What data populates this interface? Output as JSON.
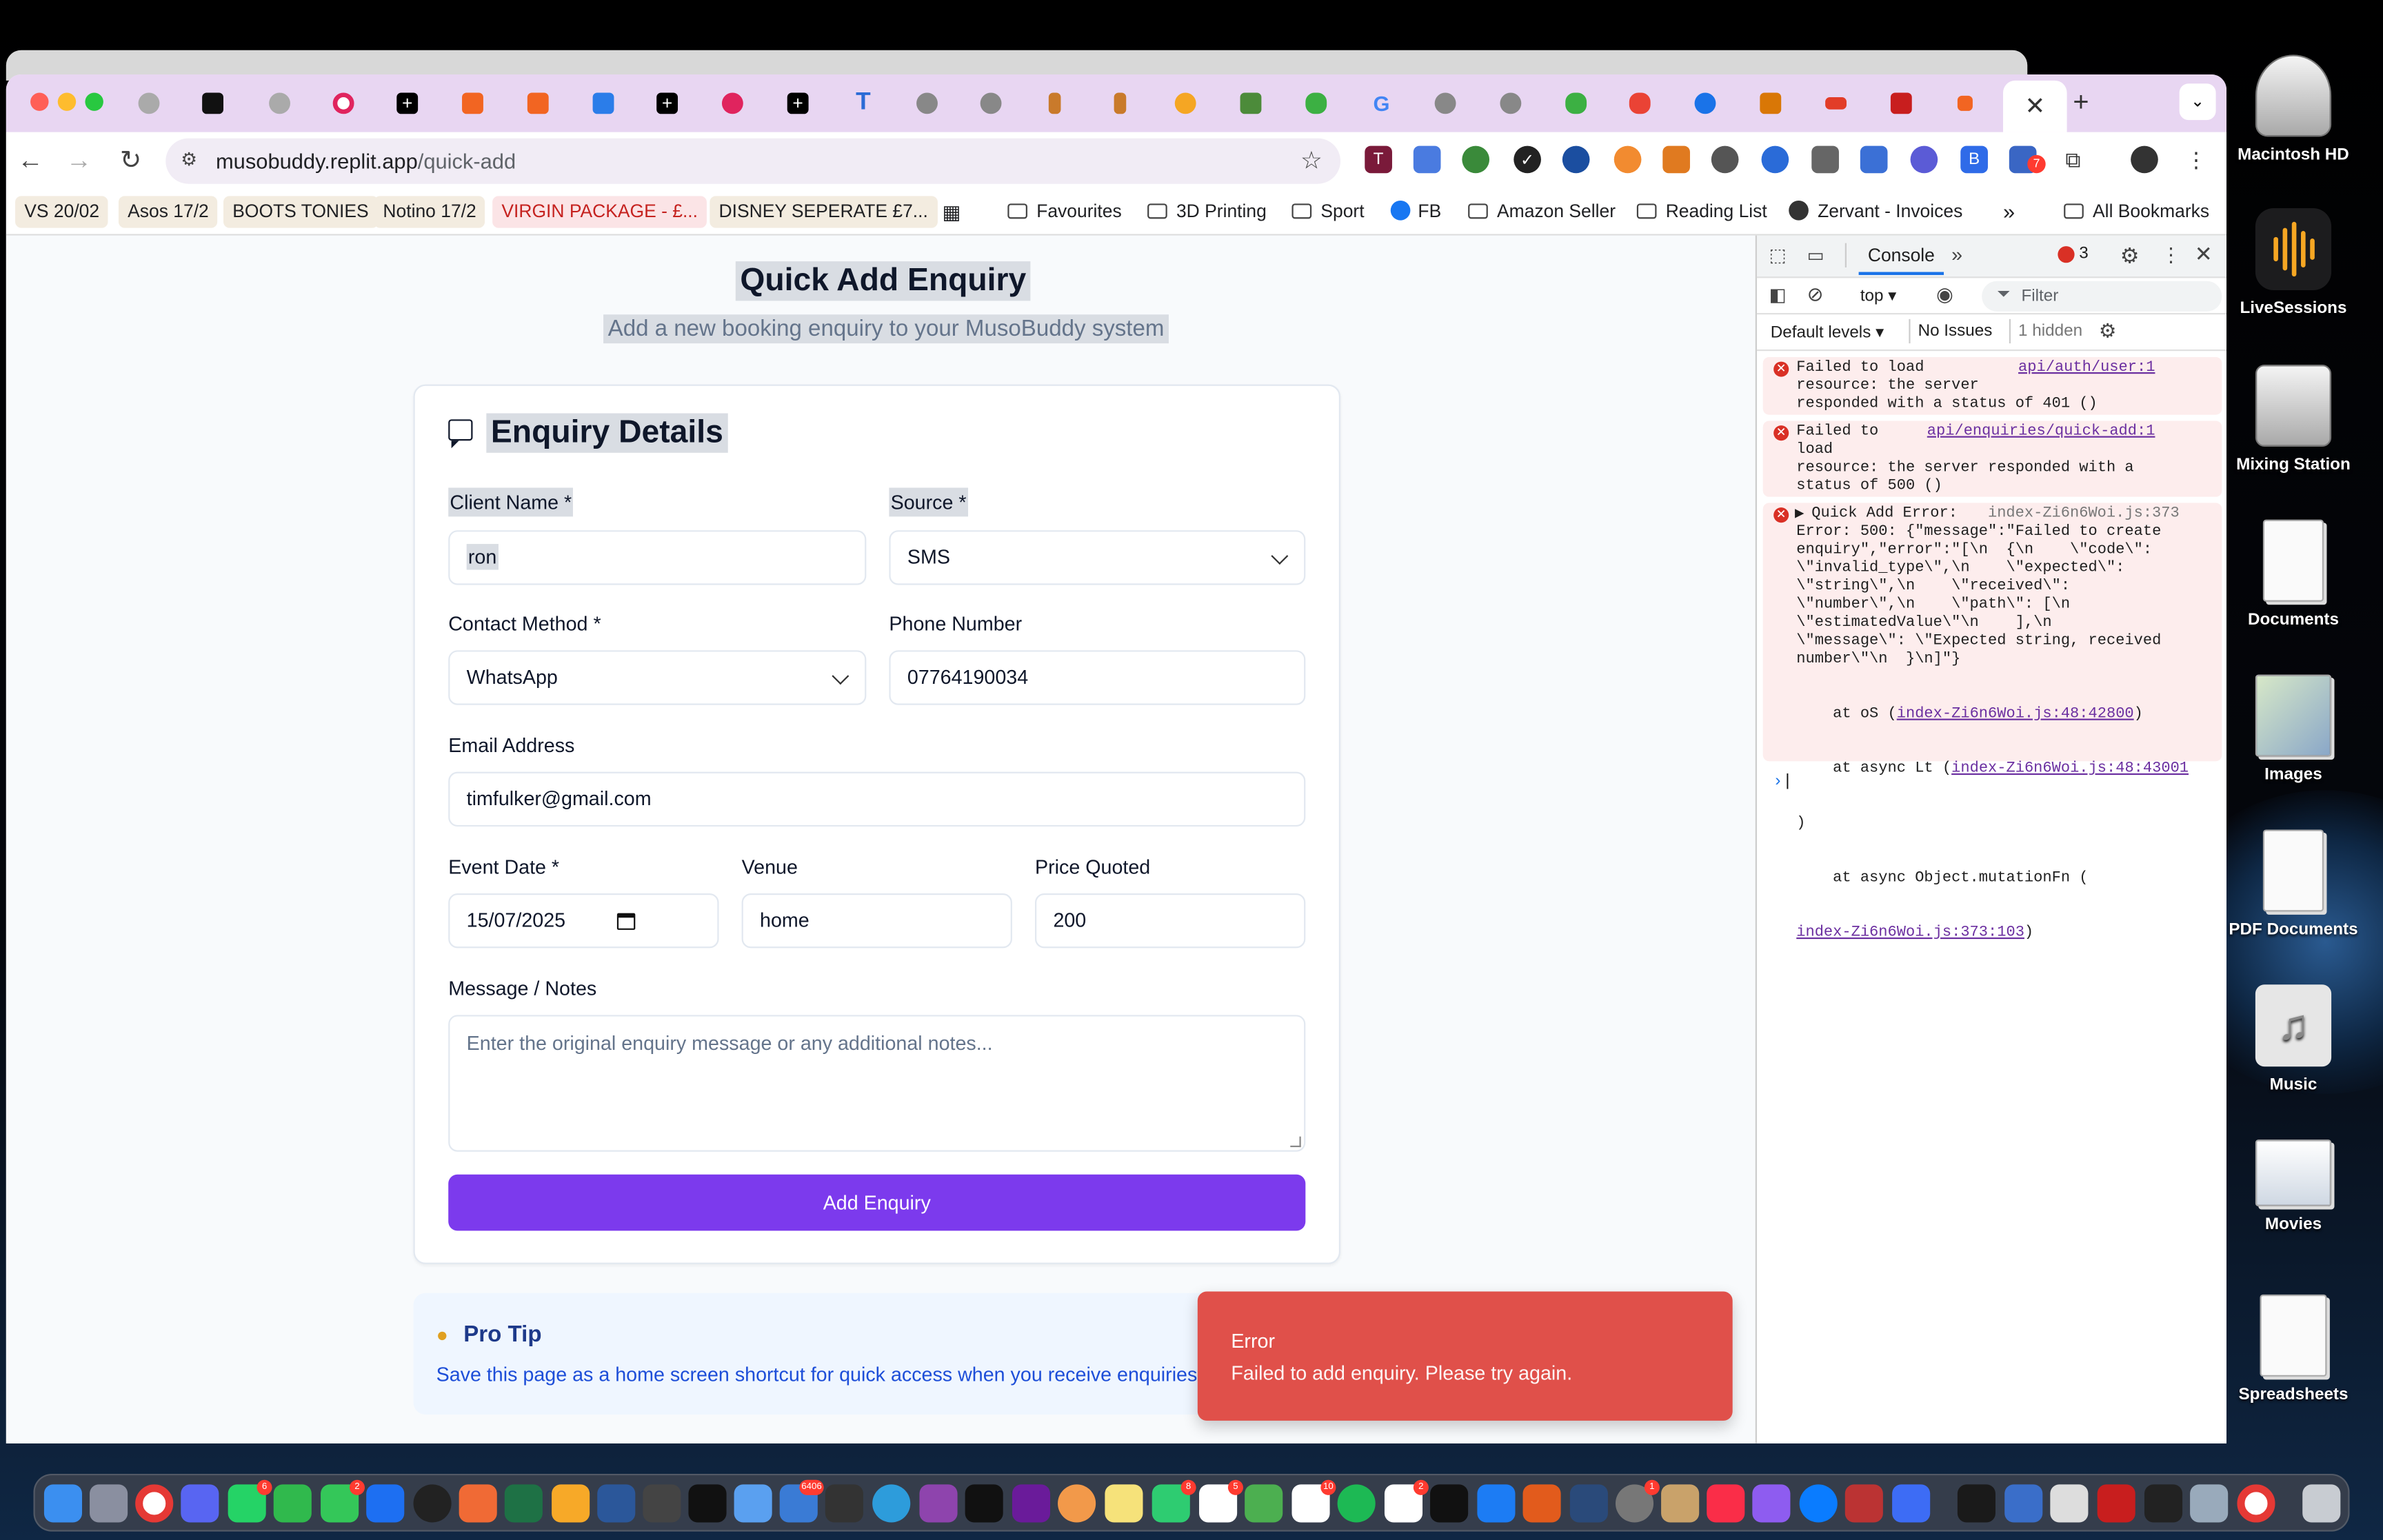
{
  "browser": {
    "url_host": "musobuddy.replit.app",
    "url_path": "/quick-add",
    "active_tab_close": "✕",
    "new_tab": "+",
    "extension_badge": "7"
  },
  "bookmarks": [
    {
      "label": "VS 20/02",
      "style": "tan"
    },
    {
      "label": "Asos 17/2",
      "style": "tan"
    },
    {
      "label": "BOOTS TONIES",
      "style": "tan"
    },
    {
      "label": "Notino 17/2",
      "style": "tan"
    },
    {
      "label": "VIRGIN PACKAGE - £...",
      "style": "red"
    },
    {
      "label": "DISNEY SEPERATE £7...",
      "style": "tan"
    },
    {
      "label": "Favourites",
      "style": "folder"
    },
    {
      "label": "3D Printing",
      "style": "folder"
    },
    {
      "label": "Sport",
      "style": "folder"
    },
    {
      "label": "FB",
      "style": "fb"
    },
    {
      "label": "Amazon Seller",
      "style": "folder"
    },
    {
      "label": "Reading List",
      "style": "folder"
    },
    {
      "label": "Zervant - Invoices",
      "style": "globe"
    },
    {
      "label": "All Bookmarks",
      "style": "folder"
    }
  ],
  "page": {
    "title": "Quick Add Enquiry",
    "subtitle": "Add a new booking enquiry to your MusoBuddy system",
    "card_title": "Enquiry Details",
    "fields": {
      "client_name": {
        "label": "Client Name *",
        "value": "ron"
      },
      "source": {
        "label": "Source *",
        "value": "SMS"
      },
      "contact_method": {
        "label": "Contact Method *",
        "value": "WhatsApp"
      },
      "phone": {
        "label": "Phone Number",
        "value": "07764190034"
      },
      "email": {
        "label": "Email Address",
        "value": "timfulker@gmail.com"
      },
      "event_date": {
        "label": "Event Date *",
        "value": "15/07/2025"
      },
      "venue": {
        "label": "Venue",
        "value": "home"
      },
      "price": {
        "label": "Price Quoted",
        "value": "200"
      },
      "message": {
        "label": "Message / Notes",
        "placeholder": "Enter the original enquiry message or any additional notes..."
      }
    },
    "submit_label": "Add Enquiry",
    "protip": {
      "title": "Pro Tip",
      "text": "Save this page as a home screen shortcut for quick access when you receive enquiries."
    },
    "toast": {
      "title": "Error",
      "text": "Failed to add enquiry. Please try again."
    }
  },
  "devtools": {
    "tab": "Console",
    "error_count": "3",
    "context": "top",
    "filter_placeholder": "Filter",
    "levels": "Default levels",
    "issues": "No Issues",
    "hidden": "1 hidden",
    "logs": [
      {
        "text": "Failed to load\nresource: the server\nresponded with a status of 401 ()",
        "link": "api/auth/user:1"
      },
      {
        "text": "Failed to\nload\nresource: the server responded with a\nstatus of 500 ()",
        "link": "api/enquiries/quick-add:1"
      },
      {
        "text": "Quick Add Error:\nError: 500: {\"message\":\"Failed to create\nenquiry\",\"error\":\"[\\n  {\\n    \\\"code\\\":\n\\\"invalid_type\\\",\\n    \\\"expected\\\":\n\\\"string\\\",\\n    \\\"received\\\":\n\\\"number\\\",\\n    \\\"path\\\": [\\n\n\\\"estimatedValue\\\"\\n    ],\\n\n\\\"message\\\": \\\"Expected string, received\nnumber\\\"\\n  }\\n]\"}",
        "link": "index-Zi6n6Woi.js:373"
      },
      {
        "stack1_prefix": "    at oS (",
        "stack1_link": "index-Zi6n6Woi.js:48:42800",
        "stack1_suffix": ")",
        "stack2_prefix": "    at async Lt (",
        "stack2_link": "index-Zi6n6Woi.js:48:43001",
        "stack2_suffix": ")",
        "stack3_prefix": "    at async Object.mutationFn (",
        "stack3_link": "index-Zi6n6Woi.js:373:103",
        "stack3_suffix": ")"
      }
    ]
  },
  "desktop": [
    {
      "label": "Macintosh HD"
    },
    {
      "label": "LiveSessions"
    },
    {
      "label": "Mixing Station"
    },
    {
      "label": "Documents"
    },
    {
      "label": "Images"
    },
    {
      "label": "PDF Documents"
    },
    {
      "label": "Music"
    },
    {
      "label": "Movies"
    },
    {
      "label": "Spreadsheets"
    }
  ],
  "dock_badges": {
    "whatsapp": "6",
    "messages": "2",
    "mail": "6406",
    "facetime": "8",
    "calendar": "5",
    "cal2": "10",
    "reminders": "2",
    "settings": "1"
  },
  "colors": {
    "accent": "#7c3aed",
    "error": "#e0504a",
    "tabstrip": "#e8d6f2"
  }
}
